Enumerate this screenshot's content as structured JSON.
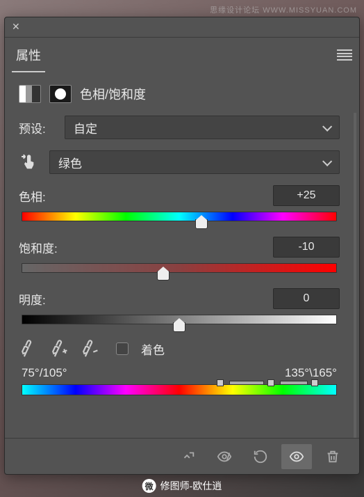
{
  "watermark": "思缘设计论坛  WWW.MISSYUAN.COM",
  "panel": {
    "tab_title": "属性",
    "adj_title": "色相/饱和度",
    "preset_label": "预设:",
    "preset_value": "自定",
    "channel_value": "绿色",
    "hue_label": "色相:",
    "hue_value": "+25",
    "sat_label": "饱和度:",
    "sat_value": "-10",
    "light_label": "明度:",
    "light_value": "0",
    "colorize_label": "着色",
    "range_left": "75°/105°",
    "range_right": "135°\\165°"
  },
  "credit": "修图师-欧仕逍",
  "chart_data": {
    "type": "adjustment",
    "hue": 25,
    "saturation": -10,
    "lightness": 0,
    "channel": "绿色",
    "range": [
      75,
      105,
      135,
      165
    ]
  }
}
